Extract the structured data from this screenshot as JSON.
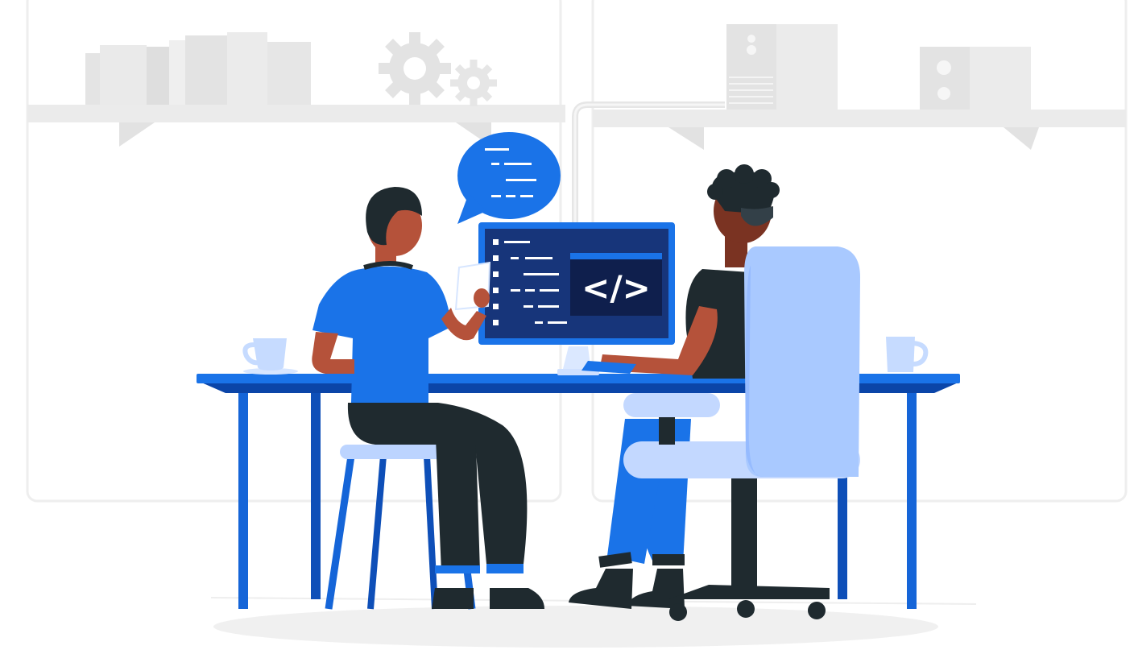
{
  "monitor": {
    "code_symbol": "</>"
  },
  "colors": {
    "primary_blue": "#1a73e8",
    "dark_blue": "#0b2a63",
    "navy_screen": "#1b3570",
    "chair_light_blue": "#a9c9ff",
    "chair_pale_blue": "#c9dcff",
    "skin_tone": "#b5523a",
    "dark_clothing": "#1f2a2f",
    "background_gray": "#ececec"
  },
  "icons": [
    "gear-icon",
    "speech-bubble-icon",
    "code-icon",
    "coffee-mug-icon"
  ]
}
